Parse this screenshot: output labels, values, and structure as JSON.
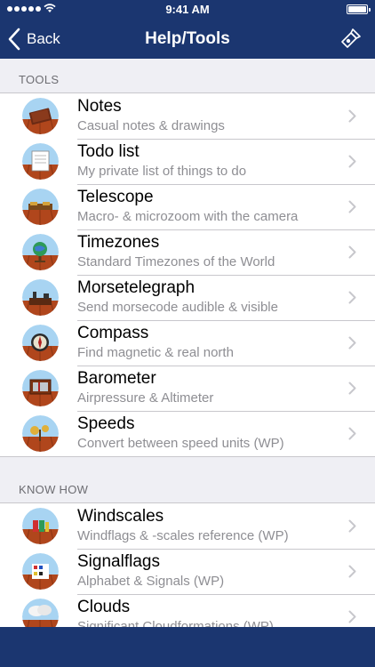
{
  "status": {
    "time": "9:41 AM"
  },
  "nav": {
    "back_label": "Back",
    "title": "Help/Tools"
  },
  "tools_section": {
    "header": "TOOLS",
    "items": [
      {
        "title": "Notes",
        "subtitle": "Casual notes & drawings",
        "icon": "notes-icon"
      },
      {
        "title": "Todo list",
        "subtitle": "My private list of things to do",
        "icon": "todo-icon"
      },
      {
        "title": "Telescope",
        "subtitle": "Macro- & microzoom with the camera",
        "icon": "telescope-icon"
      },
      {
        "title": "Timezones",
        "subtitle": "Standard Timezones of the World",
        "icon": "globe-icon"
      },
      {
        "title": "Morsetelegraph",
        "subtitle": "Send morsecode audible & visible",
        "icon": "telegraph-icon"
      },
      {
        "title": "Compass",
        "subtitle": "Find magnetic & real north",
        "icon": "compass-icon"
      },
      {
        "title": "Barometer",
        "subtitle": "Airpressure & Altimeter",
        "icon": "barometer-icon"
      },
      {
        "title": "Speeds",
        "subtitle": "Convert between speed units (WP)",
        "icon": "speeds-icon"
      }
    ]
  },
  "knowhow_section": {
    "header": "KNOW HOW",
    "items": [
      {
        "title": "Windscales",
        "subtitle": "Windflags & -scales reference (WP)",
        "icon": "windscales-icon"
      },
      {
        "title": "Signalflags",
        "subtitle": "Alphabet & Signals (WP)",
        "icon": "signalflags-icon"
      },
      {
        "title": "Clouds",
        "subtitle": "Significant Cloudformations (WP)",
        "icon": "clouds-icon"
      }
    ]
  },
  "colors": {
    "nav_bar": "#1b3670",
    "background": "#efeff4",
    "wood": "#b0461c",
    "sky": "#a8d4f2"
  }
}
